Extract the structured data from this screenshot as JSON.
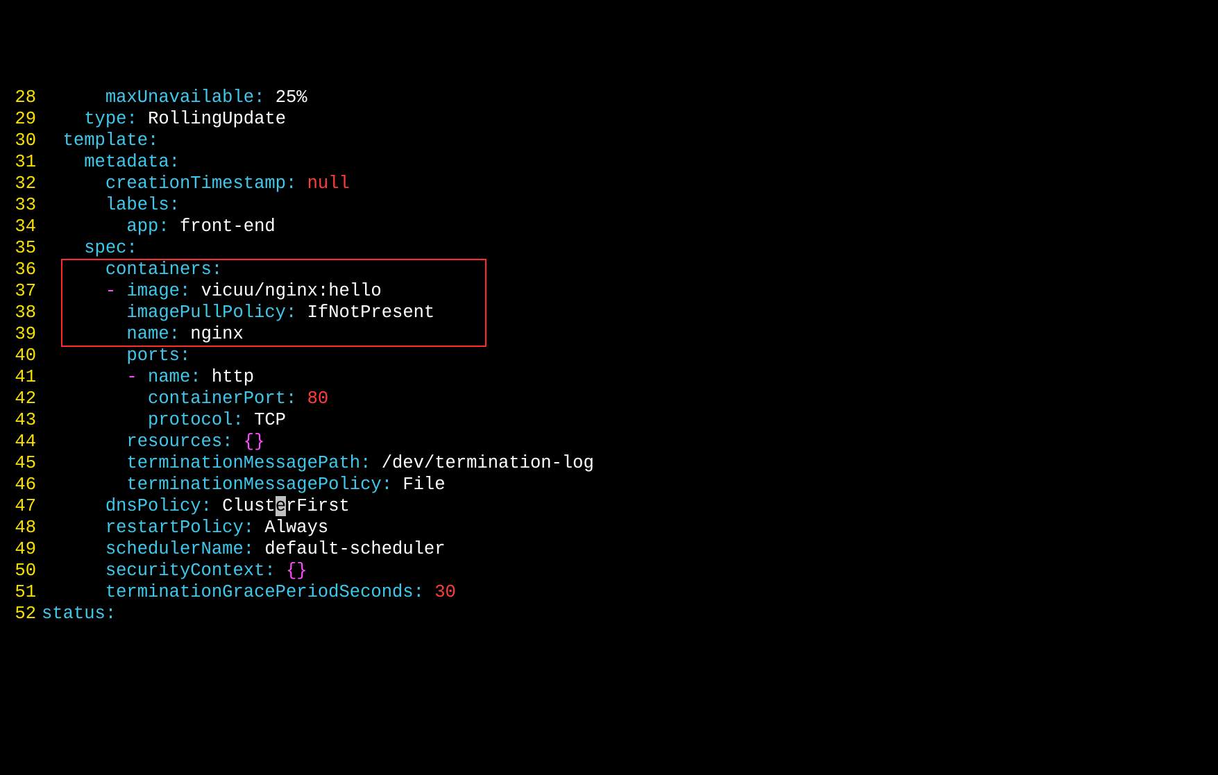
{
  "lines": [
    {
      "n": "28",
      "tokens": [
        [
          "",
          "      "
        ],
        [
          "key",
          "maxUnavailable"
        ],
        [
          "key",
          ":"
        ],
        [
          "",
          " "
        ],
        [
          "str",
          "25%"
        ]
      ]
    },
    {
      "n": "29",
      "tokens": [
        [
          "",
          "    "
        ],
        [
          "key",
          "type"
        ],
        [
          "key",
          ":"
        ],
        [
          "",
          " "
        ],
        [
          "str",
          "RollingUpdate"
        ]
      ]
    },
    {
      "n": "30",
      "tokens": [
        [
          "",
          "  "
        ],
        [
          "key",
          "template"
        ],
        [
          "key",
          ":"
        ]
      ]
    },
    {
      "n": "31",
      "tokens": [
        [
          "",
          "    "
        ],
        [
          "key",
          "metadata"
        ],
        [
          "key",
          ":"
        ]
      ]
    },
    {
      "n": "32",
      "tokens": [
        [
          "",
          "      "
        ],
        [
          "key",
          "creationTimestamp"
        ],
        [
          "key",
          ":"
        ],
        [
          "",
          " "
        ],
        [
          "null",
          "null"
        ]
      ]
    },
    {
      "n": "33",
      "tokens": [
        [
          "",
          "      "
        ],
        [
          "key",
          "labels"
        ],
        [
          "key",
          ":"
        ]
      ]
    },
    {
      "n": "34",
      "tokens": [
        [
          "",
          "        "
        ],
        [
          "key",
          "app"
        ],
        [
          "key",
          ":"
        ],
        [
          "",
          " "
        ],
        [
          "str",
          "front-end"
        ]
      ]
    },
    {
      "n": "35",
      "tokens": [
        [
          "",
          "    "
        ],
        [
          "key",
          "spec"
        ],
        [
          "key",
          ":"
        ]
      ]
    },
    {
      "n": "36",
      "tokens": [
        [
          "",
          "      "
        ],
        [
          "key",
          "containers"
        ],
        [
          "key",
          ":"
        ]
      ]
    },
    {
      "n": "37",
      "tokens": [
        [
          "",
          "      "
        ],
        [
          "dash",
          "-"
        ],
        [
          "",
          " "
        ],
        [
          "key",
          "image"
        ],
        [
          "key",
          ":"
        ],
        [
          "",
          " "
        ],
        [
          "str",
          "vicuu/nginx:hello"
        ]
      ]
    },
    {
      "n": "38",
      "tokens": [
        [
          "",
          "        "
        ],
        [
          "key",
          "imagePullPolicy"
        ],
        [
          "key",
          ":"
        ],
        [
          "",
          " "
        ],
        [
          "str",
          "IfNotPresent"
        ]
      ]
    },
    {
      "n": "39",
      "tokens": [
        [
          "",
          "        "
        ],
        [
          "key",
          "name"
        ],
        [
          "key",
          ":"
        ],
        [
          "",
          " "
        ],
        [
          "str",
          "nginx"
        ]
      ]
    },
    {
      "n": "40",
      "tokens": [
        [
          "",
          "        "
        ],
        [
          "key",
          "ports"
        ],
        [
          "key",
          ":"
        ]
      ]
    },
    {
      "n": "41",
      "tokens": [
        [
          "",
          "        "
        ],
        [
          "dash",
          "-"
        ],
        [
          "",
          " "
        ],
        [
          "key",
          "name"
        ],
        [
          "key",
          ":"
        ],
        [
          "",
          " "
        ],
        [
          "str",
          "http"
        ]
      ]
    },
    {
      "n": "42",
      "tokens": [
        [
          "",
          "          "
        ],
        [
          "key",
          "containerPort"
        ],
        [
          "key",
          ":"
        ],
        [
          "",
          " "
        ],
        [
          "num",
          "80"
        ]
      ]
    },
    {
      "n": "43",
      "tokens": [
        [
          "",
          "          "
        ],
        [
          "key",
          "protocol"
        ],
        [
          "key",
          ":"
        ],
        [
          "",
          " "
        ],
        [
          "str",
          "TCP"
        ]
      ]
    },
    {
      "n": "44",
      "tokens": [
        [
          "",
          "        "
        ],
        [
          "key",
          "resources"
        ],
        [
          "key",
          ":"
        ],
        [
          "",
          " "
        ],
        [
          "brc",
          "{}"
        ]
      ]
    },
    {
      "n": "45",
      "tokens": [
        [
          "",
          "        "
        ],
        [
          "key",
          "terminationMessagePath"
        ],
        [
          "key",
          ":"
        ],
        [
          "",
          " "
        ],
        [
          "str",
          "/dev/termination-log"
        ]
      ]
    },
    {
      "n": "46",
      "tokens": [
        [
          "",
          "        "
        ],
        [
          "key",
          "terminationMessagePolicy"
        ],
        [
          "key",
          ":"
        ],
        [
          "",
          " "
        ],
        [
          "str",
          "File"
        ]
      ]
    },
    {
      "n": "47",
      "tokens": [
        [
          "",
          "      "
        ],
        [
          "key",
          "dnsPolicy"
        ],
        [
          "key",
          ":"
        ],
        [
          "",
          " "
        ],
        [
          "str",
          "Clust"
        ],
        [
          "cursor",
          "e"
        ],
        [
          "str",
          "rFirst"
        ]
      ]
    },
    {
      "n": "48",
      "tokens": [
        [
          "",
          "      "
        ],
        [
          "key",
          "restartPolicy"
        ],
        [
          "key",
          ":"
        ],
        [
          "",
          " "
        ],
        [
          "str",
          "Always"
        ]
      ]
    },
    {
      "n": "49",
      "tokens": [
        [
          "",
          "      "
        ],
        [
          "key",
          "schedulerName"
        ],
        [
          "key",
          ":"
        ],
        [
          "",
          " "
        ],
        [
          "str",
          "default-scheduler"
        ]
      ]
    },
    {
      "n": "50",
      "tokens": [
        [
          "",
          "      "
        ],
        [
          "key",
          "securityContext"
        ],
        [
          "key",
          ":"
        ],
        [
          "",
          " "
        ],
        [
          "brc",
          "{}"
        ]
      ]
    },
    {
      "n": "51",
      "tokens": [
        [
          "",
          "      "
        ],
        [
          "key",
          "terminationGracePeriodSeconds"
        ],
        [
          "key",
          ":"
        ],
        [
          "",
          " "
        ],
        [
          "num",
          "30"
        ]
      ]
    },
    {
      "n": "52",
      "tokens": [
        [
          "key",
          "status"
        ],
        [
          "key",
          ":"
        ]
      ]
    }
  ]
}
